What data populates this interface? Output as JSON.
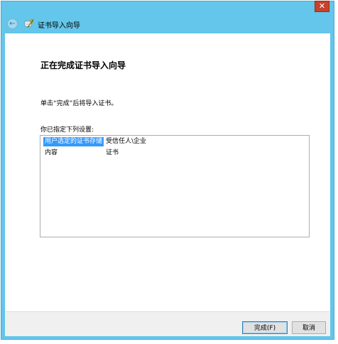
{
  "titlebar": {
    "close_label": "✕",
    "back_label": "←",
    "title": "证书导入向导"
  },
  "main": {
    "heading": "正在完成证书导入向导",
    "instruction": "单击“完成”后将导入证书。",
    "list_caption": "你已指定下列设置:",
    "settings": [
      {
        "key": "用户选定的证书存储",
        "value": "受信任人\\企业"
      },
      {
        "key": "内容",
        "value": "证书"
      }
    ]
  },
  "footer": {
    "finish_label": "完成(F)",
    "cancel_label": "取消"
  },
  "colors": {
    "accent": "#63c6ea",
    "selection": "#3399ff",
    "close": "#c7412d"
  }
}
